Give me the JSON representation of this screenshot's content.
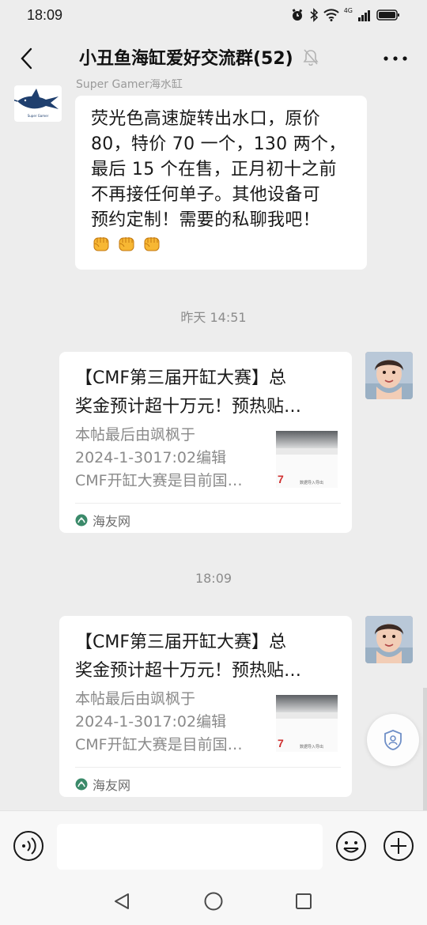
{
  "status_bar": {
    "time": "18:09",
    "network": "4G"
  },
  "header": {
    "title": "小丑鱼海缸爱好交流群(52)"
  },
  "messages": {
    "first": {
      "sender": "Super Gamer海水缸",
      "avatar_text": "Super Gamer",
      "lines": [
        "荧光色高速旋转出水口，原价",
        "80，特价 70 一个，130 两个，",
        "最后 15 个在售，正月初十之前",
        "不再接任何单子。其他设备可",
        "预约定制！需要的私聊我吧！"
      ]
    },
    "timestamp_1": "昨天 14:51",
    "timestamp_2": "18:09",
    "card_1": {
      "title_line_1": "【CMF第三届开缸大赛】总",
      "title_line_2": "奖金预计超十万元！预热贴…",
      "desc_line_1": "本帖最后由飒枫于",
      "desc_line_2": "2024-1-3017:02编辑",
      "desc_line_3": "CMF开缸大赛是目前国…",
      "thumb_number": "7",
      "thumb_caption": "数据导入导出",
      "source": "海友网"
    },
    "card_2": {
      "title_line_1": "【CMF第三届开缸大赛】总",
      "title_line_2": "奖金预计超十万元！预热贴…",
      "desc_line_1": "本帖最后由飒枫于",
      "desc_line_2": "2024-1-3017:02编辑",
      "desc_line_3": "CMF开缸大赛是目前国…",
      "thumb_number": "7",
      "thumb_caption": "数据导入导出",
      "source": "海友网"
    }
  },
  "input": {
    "placeholder": ""
  },
  "colors": {
    "background": "#ededed",
    "bubble": "#ffffff",
    "timestamp": "#8c8c8c",
    "source_green": "#3b8a6a"
  }
}
